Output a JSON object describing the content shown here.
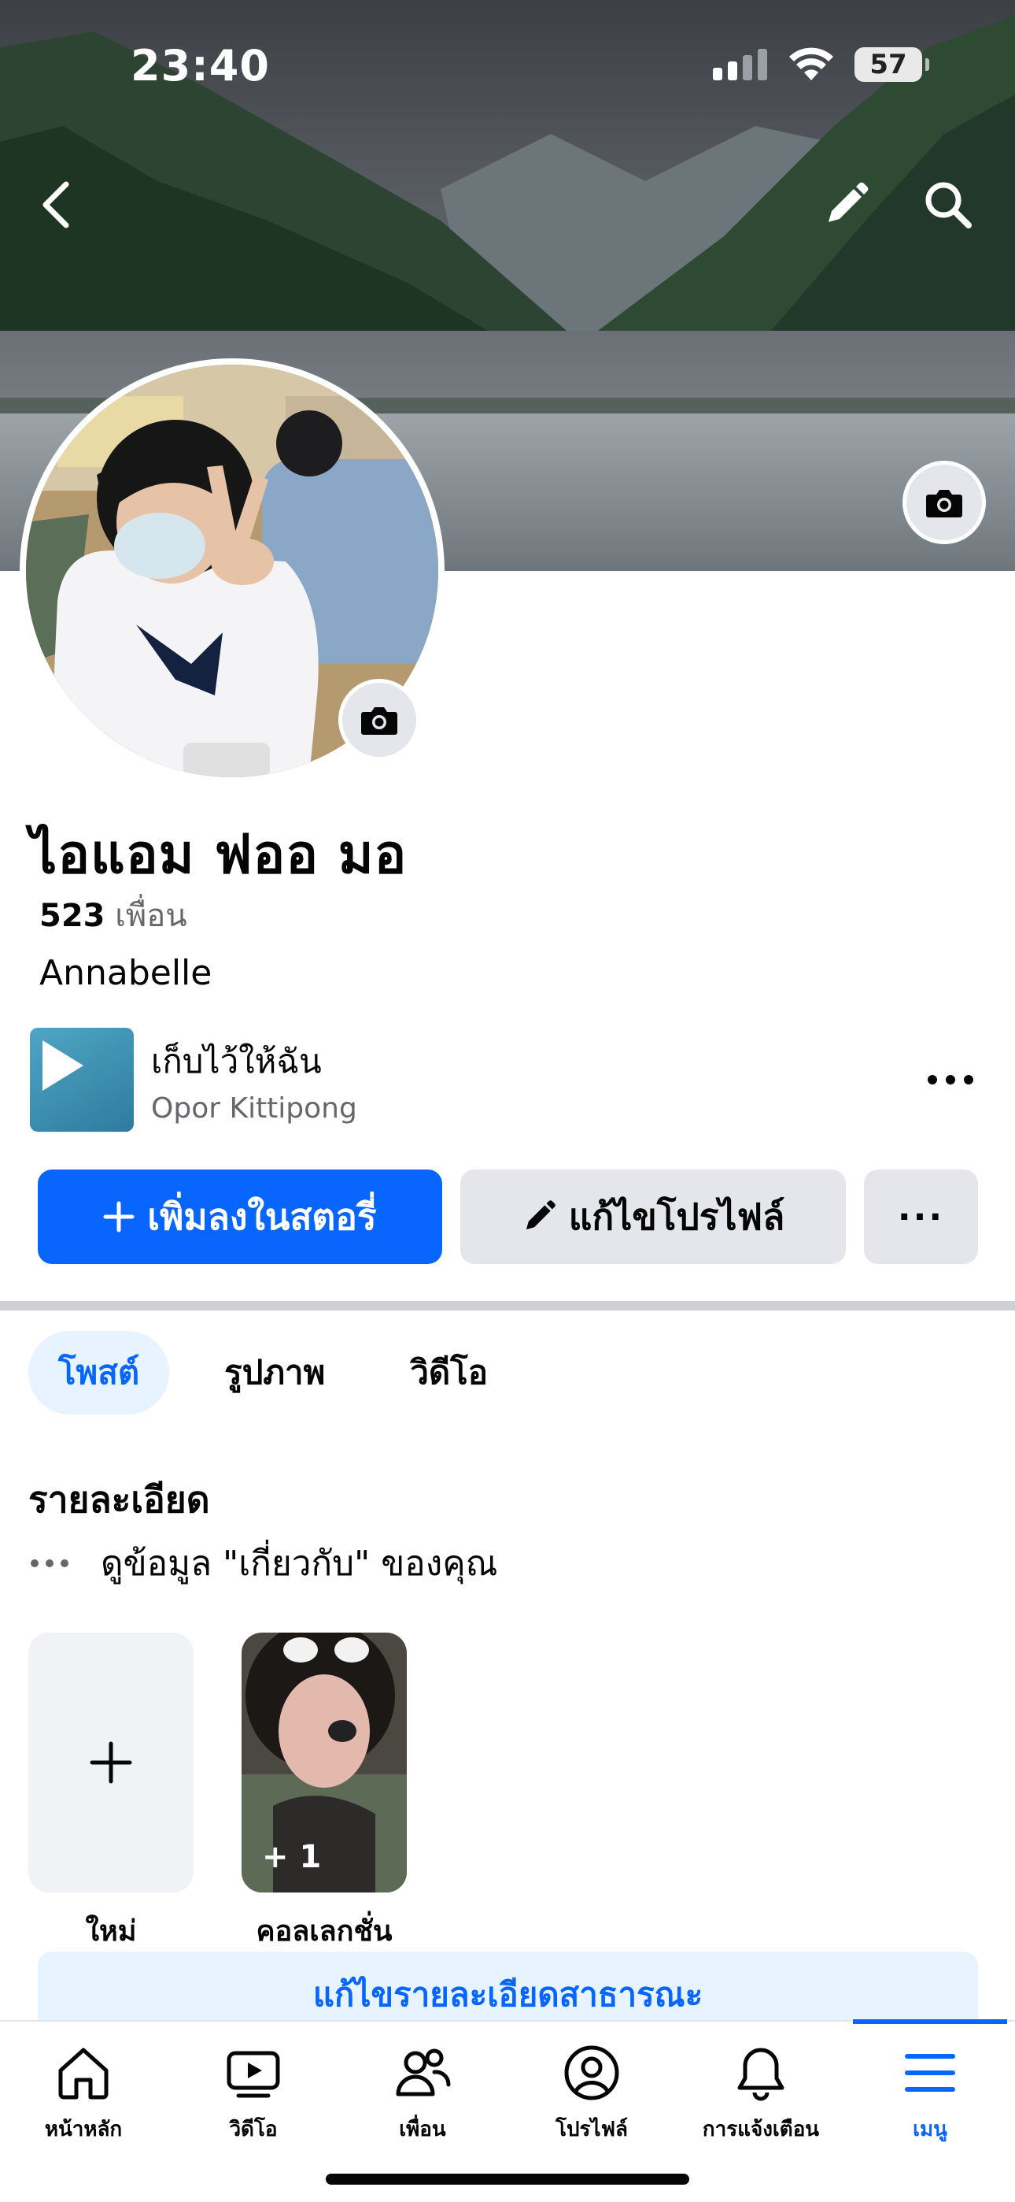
{
  "status_bar": {
    "time": "23:40",
    "battery": "57"
  },
  "icons": {
    "back": "chevron-left-icon",
    "edit": "pencil-icon",
    "search": "search-icon",
    "camera": "camera-icon",
    "more": "ellipsis-icon"
  },
  "profile": {
    "name": "ไอแอม ฟออ มอ",
    "friends_count": "523",
    "friends_label": "เพื่อน",
    "bio": "Annabelle"
  },
  "music": {
    "title": "เก็บไว้ให้ฉัน",
    "artist": "Opor Kittipong"
  },
  "actions": {
    "add_story": "เพิ่มลงในสตอรี่",
    "edit_profile": "แก้ไขโปรไฟล์",
    "more": "···"
  },
  "tabs": [
    {
      "label": "โพสต์",
      "active": true
    },
    {
      "label": "รูปภาพ",
      "active": false
    },
    {
      "label": "วิดีโอ",
      "active": false
    }
  ],
  "details": {
    "title": "รายละเอียด",
    "about_prompt": "ดูข้อมูล \"เกี่ยวกับ\" ของคุณ"
  },
  "highlights": [
    {
      "label": "ใหม่"
    },
    {
      "label": "คอลเลกชั่น",
      "count": "+ 1"
    }
  ],
  "edit_public_details": "แก้ไขรายละเอียดสาธารณะ",
  "bottom_nav": [
    {
      "label": "หน้าหลัก",
      "icon": "home-icon"
    },
    {
      "label": "วิดีโอ",
      "icon": "video-icon"
    },
    {
      "label": "เพื่อน",
      "icon": "friends-icon"
    },
    {
      "label": "โปรไฟล์",
      "icon": "profile-icon"
    },
    {
      "label": "การแจ้งเตือน",
      "icon": "bell-icon"
    },
    {
      "label": "เมนู",
      "icon": "menu-icon",
      "active": true
    }
  ],
  "colors": {
    "accent": "#0866ff",
    "button_gray": "#e4e6eb",
    "active_tab_bg": "#e7f3ff"
  }
}
